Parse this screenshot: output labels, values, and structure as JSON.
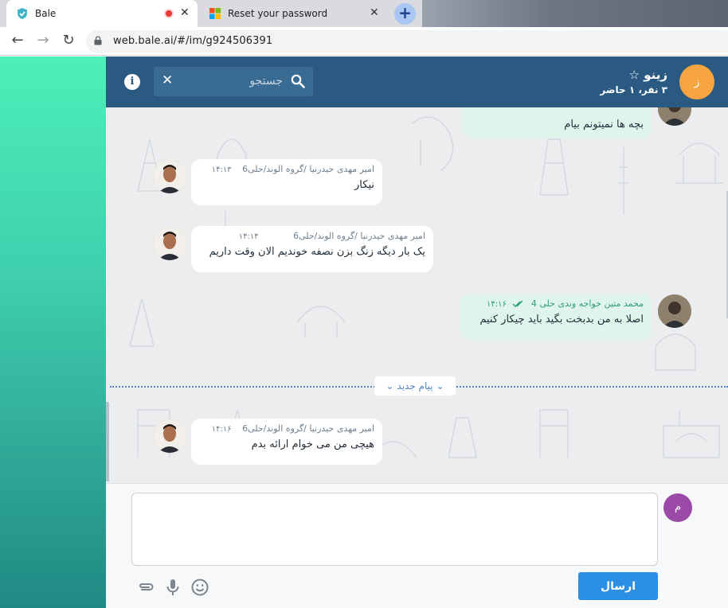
{
  "browser": {
    "tabs": [
      {
        "title": "Bale",
        "active": true
      },
      {
        "title": "Reset your password",
        "active": false
      }
    ],
    "new_tab": "+",
    "url": "web.bale.ai/#/im/g924506391"
  },
  "chat": {
    "group_avatar_letter": "ز",
    "group_name": "زینو ☆",
    "group_status": "۳ نفر، ۱ حاضر",
    "search_placeholder": "جستجو",
    "info": "i"
  },
  "messages": [
    {
      "id": "m0",
      "direction": "out",
      "sender": "",
      "time": "",
      "text": "بچه ها نمیتونم بیام"
    },
    {
      "id": "m1",
      "direction": "in",
      "sender": "امیر مهدی حیدرنیا /گروه الوند/حلی6",
      "time": "۱۴:۱۳",
      "text": "نیکار"
    },
    {
      "id": "m2",
      "direction": "in",
      "sender": "امیر مهدی حیدرنیا /گروه الوند/حلی6",
      "time": "۱۴:۱۴",
      "text": "یک بار دیگه زنگ بزن نصفه خوندیم الان وقت داریم"
    },
    {
      "id": "m3",
      "direction": "out",
      "sender": "محمد متین خواجه وندی حلی 4",
      "time": "۱۴:۱۶",
      "text": "اصلا به من بدبخت بگید باید چیکار کنیم"
    },
    {
      "id": "m4",
      "direction": "in",
      "sender": "امیر مهدی حیدرنیا /گروه الوند/حلی6",
      "time": "۱۴:۱۶",
      "text": "هیچی من می خوام ارائه بدم"
    }
  ],
  "new_messages_label": "پیام جدید",
  "composer": {
    "my_avatar_letter": "م",
    "input_value": "",
    "send_label": "ارسال"
  },
  "colors": {
    "header": "#2a5a81",
    "send_button": "#2b8fe6",
    "outgoing_bubble": "#dff5ec",
    "group_avatar": "#f6a541",
    "my_avatar": "#9b4aa8"
  }
}
